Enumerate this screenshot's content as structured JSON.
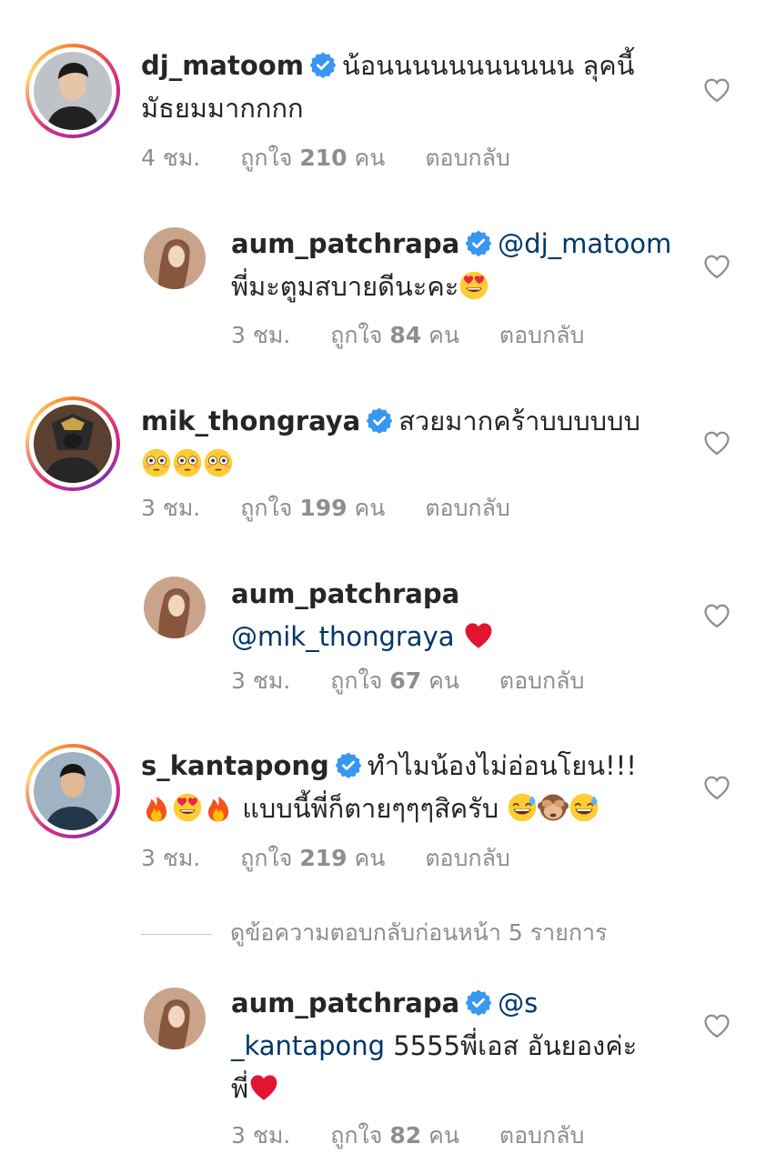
{
  "comments": [
    {
      "username": "dj_matoom",
      "text": "น้อนนนนนนนนนนน ลุคนี้ มัธยมมากกกก",
      "time": "4 ชม.",
      "likes_prefix": "ถูกใจ",
      "likes_count": "210",
      "likes_suffix": "คน",
      "reply_label": "ตอบกลับ"
    },
    {
      "username": "aum_patchrapa",
      "mention": "@dj_matoom",
      "text": "พี่มะตูมสบายดีนะคะ",
      "time": "3 ชม.",
      "likes_prefix": "ถูกใจ",
      "likes_count": "84",
      "likes_suffix": "คน",
      "reply_label": "ตอบกลับ"
    },
    {
      "username": "mik_thongraya",
      "text": "สวยมากคร้าบบบบบบ",
      "time": "3 ชม.",
      "likes_prefix": "ถูกใจ",
      "likes_count": "199",
      "likes_suffix": "คน",
      "reply_label": "ตอบกลับ"
    },
    {
      "username": "aum_patchrapa",
      "mention": "@mik_thongraya",
      "time": "3 ชม.",
      "likes_prefix": "ถูกใจ",
      "likes_count": "67",
      "likes_suffix": "คน",
      "reply_label": "ตอบกลับ"
    },
    {
      "username": "s_kantapong",
      "text": "ทำไมน้องไม่อ่อนโยน!!!",
      "text2": "แบบนี้พี่ก็ตายๆๆๆสิครับ",
      "time": "3 ชม.",
      "likes_prefix": "ถูกใจ",
      "likes_count": "219",
      "likes_suffix": "คน",
      "reply_label": "ตอบกลับ"
    },
    {
      "username": "aum_patchrapa",
      "mention_a": "@s",
      "mention_b": "_kantapong",
      "text": "5555พี่เอส อันยองค่ะ",
      "text2": "พี่",
      "time": "3 ชม.",
      "likes_prefix": "ถูกใจ",
      "likes_count": "82",
      "likes_suffix": "คน",
      "reply_label": "ตอบกลับ"
    }
  ],
  "view_previous_replies": "ดูข้อความตอบกลับก่อนหน้า 5 รายการ",
  "icons": {
    "verified": "verified-badge-icon",
    "heart": "heart-outline-icon",
    "emoji_heart_eyes": "heart-eyes-emoji",
    "emoji_flushed": "flushed-face-emoji",
    "emoji_red_heart": "red-heart-emoji",
    "emoji_fire": "fire-emoji",
    "emoji_sweat_smile": "sweat-smile-emoji",
    "emoji_see_no_evil": "see-no-evil-monkey-emoji"
  },
  "colors": {
    "verified": "#3897f0",
    "mention": "#00376b",
    "meta": "#8e8e8e"
  }
}
